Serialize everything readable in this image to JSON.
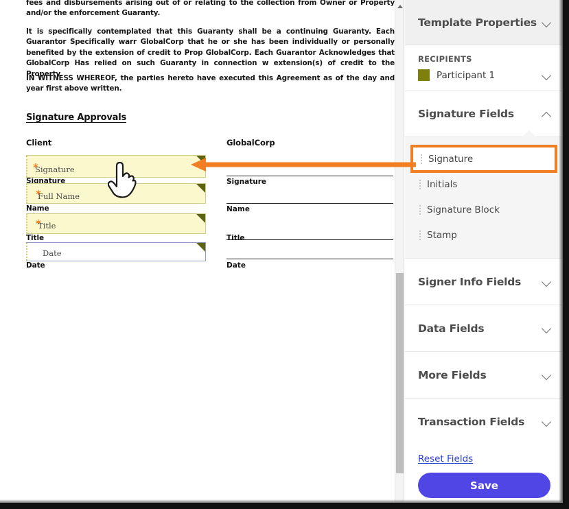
{
  "document": {
    "paragraphs": [
      "fees and disbursements arising out of or relating to the collection from Owner or Property and/or the enforcement Guaranty.",
      "It is specifically contemplated that this Guaranty shall be a continuing Guaranty. Each Guarantor Specifically warr GlobalCorp that he or she has been individually or personally benefited by the extension of credit to Prop GlobalCorp. Each Guarantor Acknowledges that GlobalCorp Has relied on such Guaranty in connection w extension(s) of credit to the Property.",
      "IN WITNESS WHEREOF, the parties hereto have executed this Agreement as of the day and year first above written."
    ],
    "section_title": "Signature Approvals",
    "columns": {
      "client_heading": "Client",
      "corp_heading": "GlobalCorp"
    },
    "client_fields": [
      {
        "placeholder": "Signature",
        "label": "Signature",
        "required": true,
        "style": "highlight"
      },
      {
        "placeholder": "Full Name",
        "label": "Name",
        "required": true,
        "style": "highlight"
      },
      {
        "placeholder": "Title",
        "label": "Title",
        "required": true,
        "style": "highlight"
      },
      {
        "placeholder": "Date",
        "label": "Date",
        "required": false,
        "style": "plain"
      }
    ],
    "corp_labels": [
      "Signature",
      "Name",
      "Title",
      "Date"
    ],
    "cursor": "pointing-hand-cursor",
    "scrollbar": {
      "position_percent": 55
    }
  },
  "panel": {
    "title": "Template Properties",
    "recipients": {
      "heading": "RECIPIENTS",
      "selected": "Participant 1",
      "swatch_color": "#7f7f0d"
    },
    "sections": [
      {
        "title": "Signature Fields",
        "expanded": true,
        "items": [
          "Signature",
          "Initials",
          "Signature Block",
          "Stamp"
        ],
        "selected_item": "Signature"
      },
      {
        "title": "Signer Info Fields",
        "expanded": false,
        "items": []
      },
      {
        "title": "Data Fields",
        "expanded": false,
        "items": []
      },
      {
        "title": "More Fields",
        "expanded": false,
        "items": []
      },
      {
        "title": "Transaction Fields",
        "expanded": false,
        "items": []
      }
    ],
    "reset_label": "Reset Fields",
    "save_label": "Save"
  },
  "annotation": {
    "color": "#ef7f22",
    "description": "arrow linking the Signature palette item to the Signature field placed on the document"
  }
}
